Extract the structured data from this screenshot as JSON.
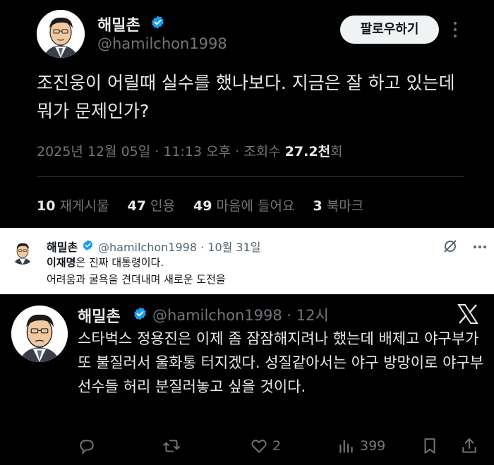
{
  "post_main": {
    "author_name": "해밀촌",
    "handle": "@hamilchon1998",
    "follow_label": "팔로우하기",
    "text": "조진웅이 어릴때 실수를 했나보다. 지금은 잘 하고 있는데 뭐가 문제인가?",
    "date": "2025년 12월 05일 · 11:13 오후 · 조회수 ",
    "views": "27.2천",
    "views_suffix": "회",
    "stats": {
      "reposts_count": "10",
      "reposts_label": "재게시물",
      "quotes_count": "47",
      "quotes_label": "인용",
      "likes_count": "49",
      "likes_label": "마음에 들어요",
      "bookmarks_count": "3",
      "bookmarks_label": "북마크"
    }
  },
  "post_quoted": {
    "author_name": "해밀촌",
    "handle_date": "@hamilchon1998 · 10월 31일",
    "line1_bold": "이재명",
    "line1_rest": "은 진짜 대통령이다.",
    "line2": "어려움과 굴욕을 견뎌내며 새로운 도전을"
  },
  "post_third": {
    "author_name": "해밀촌",
    "handle_time": "@hamilchon1998 · 12시",
    "text": "스타벅스 정용진은 이제 좀 잠잠해지려나 했는데 배제고 야구부가 또 불질러서 울화통 터지겠다. 성질같아서는 야구 방망이로 야구부 선수들 허리 분질러놓고 싶을 것이다.",
    "likes": "2",
    "views": "399"
  },
  "colors": {
    "verified_blue": "#1d9bf0",
    "dark_bg": "#000000",
    "muted_dark": "#71767b",
    "light_bg": "#ffffff"
  }
}
